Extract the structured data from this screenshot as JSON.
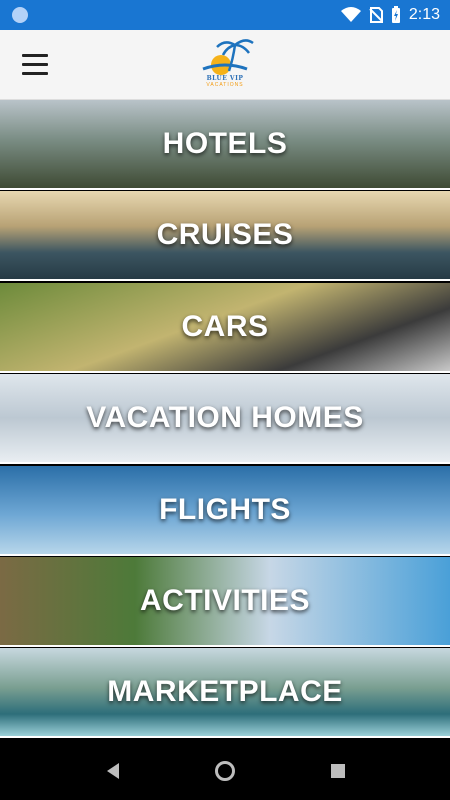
{
  "status_bar": {
    "time": "2:13",
    "icons": [
      "app-notification-icon",
      "wifi-icon",
      "no-sim-icon",
      "battery-charging-icon"
    ]
  },
  "app_bar": {
    "menu_icon": "hamburger-menu-icon",
    "logo_text": "BLUE VIP",
    "logo_subtext": "VACATIONS"
  },
  "categories": [
    {
      "label": "HOTELS"
    },
    {
      "label": "CRUISES"
    },
    {
      "label": "CARS"
    },
    {
      "label": "VACATION HOMES"
    },
    {
      "label": "FLIGHTS"
    },
    {
      "label": "ACTIVITIES"
    },
    {
      "label": "MARKETPLACE"
    }
  ],
  "nav_bar": {
    "back_icon": "back-triangle-icon",
    "home_icon": "home-circle-icon",
    "recents_icon": "recents-square-icon"
  }
}
